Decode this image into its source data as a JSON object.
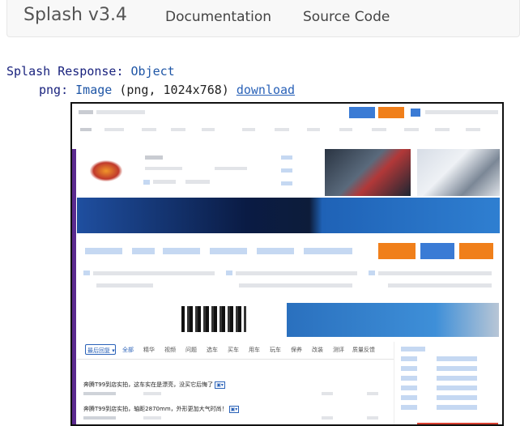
{
  "navbar": {
    "brand": "Splash v3.4",
    "links": [
      "Documentation",
      "Source Code"
    ]
  },
  "response": {
    "label": "Splash Response:",
    "type": "Object",
    "png_key": "png:",
    "png_type": "Image",
    "png_info": "(png, 1024x768)",
    "download_label": "download"
  },
  "screenshot": {
    "tabs": [
      "全部",
      "精华",
      "视频",
      "问题",
      "选车",
      "买车",
      "用车",
      "玩车",
      "保养",
      "改装",
      "测评",
      "质量反馈"
    ],
    "sort_label": "最后回复 ▾",
    "news": [
      "奔腾T99到店实拍，这车实在是漂亮，没买它后悔了",
      "奔腾T99到店实拍，轴距2870mm，外形更加大气时尚！"
    ],
    "colors": {
      "accent_blue": "#3a7bd5",
      "accent_orange": "#f07f1a",
      "sidebar_purple": "#5b2a8f"
    }
  }
}
